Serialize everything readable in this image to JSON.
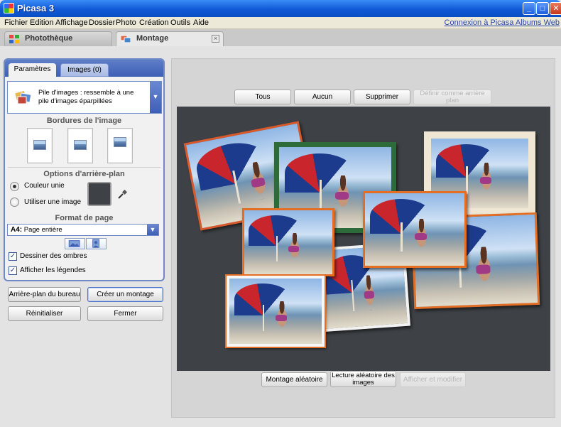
{
  "window": {
    "title": "Picasa 3",
    "min": "_",
    "max": "□",
    "close": "✕"
  },
  "menu": {
    "items": [
      "Fichier",
      "Edition",
      "Affichage",
      "Dossier",
      "Photo",
      "Création",
      "Outils",
      "Aide"
    ],
    "link": "Connexion à Picasa Albums Web"
  },
  "tabs": {
    "phototheque": "Photothèque",
    "montage": "Montage",
    "close": "×"
  },
  "panel": {
    "tab_params": "Paramètres",
    "tab_images": "Images (0)",
    "collage_type": "Pile d'images : ressemble à une pile d'images éparpillées",
    "borders_title": "Bordures de l'image",
    "bg_title": "Options d'arrière-plan",
    "bg_solid": "Couleur unie",
    "bg_image": "Utiliser une image",
    "bg_color": "#3e4246",
    "format_title": "Format de page",
    "format_size": "A4:",
    "format_value": "Page entière",
    "shadows_label": "Dessiner des ombres",
    "captions_label": "Afficher les légendes",
    "check_mark": "✓"
  },
  "left_buttons": {
    "desktop_bg": "Arrière-plan du bureau",
    "create": "Créer un montage",
    "reset": "Réinitialiser",
    "close": "Fermer"
  },
  "toolbar": {
    "all": "Tous",
    "none": "Aucun",
    "delete": "Supprimer",
    "set_bg": "Définir comme arrière plan"
  },
  "bottom": {
    "random": "Montage aléatoire",
    "slideshow": "Lecture aléatoire des images",
    "view_edit": "Afficher et modifier"
  },
  "colors": {
    "accent": "#6f88c6",
    "photo_border": "#e46f24",
    "titlebar": "#1058d6"
  }
}
